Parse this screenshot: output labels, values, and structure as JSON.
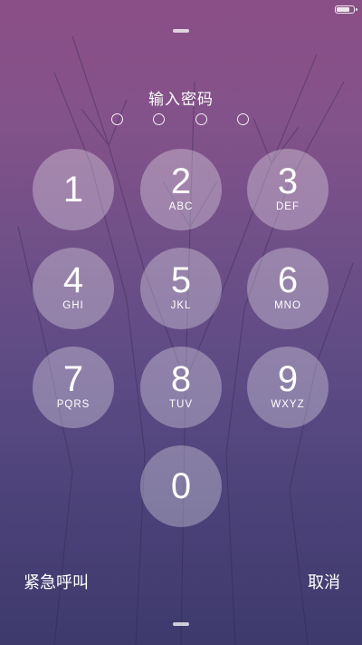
{
  "status_bar": {
    "battery_level": 0.85,
    "battery_icon": "battery-icon"
  },
  "lock_screen": {
    "title": "输入密码",
    "passcode_dots_total": 4,
    "passcode_dots_filled": 0
  },
  "keypad": {
    "keys": [
      {
        "digit": "1",
        "letters": ""
      },
      {
        "digit": "2",
        "letters": "ABC"
      },
      {
        "digit": "3",
        "letters": "DEF"
      },
      {
        "digit": "4",
        "letters": "GHI"
      },
      {
        "digit": "5",
        "letters": "JKL"
      },
      {
        "digit": "6",
        "letters": "MNO"
      },
      {
        "digit": "7",
        "letters": "PQRS"
      },
      {
        "digit": "8",
        "letters": "TUV"
      },
      {
        "digit": "9",
        "letters": "WXYZ"
      },
      {
        "digit": "0",
        "letters": ""
      }
    ]
  },
  "footer": {
    "emergency_label": "紧急呼叫",
    "cancel_label": "取消"
  },
  "colors": {
    "background_top": "#8a4f86",
    "background_bottom": "#3e3a6c",
    "key_fill": "rgba(255,255,255,0.30)",
    "text": "#ffffff"
  }
}
